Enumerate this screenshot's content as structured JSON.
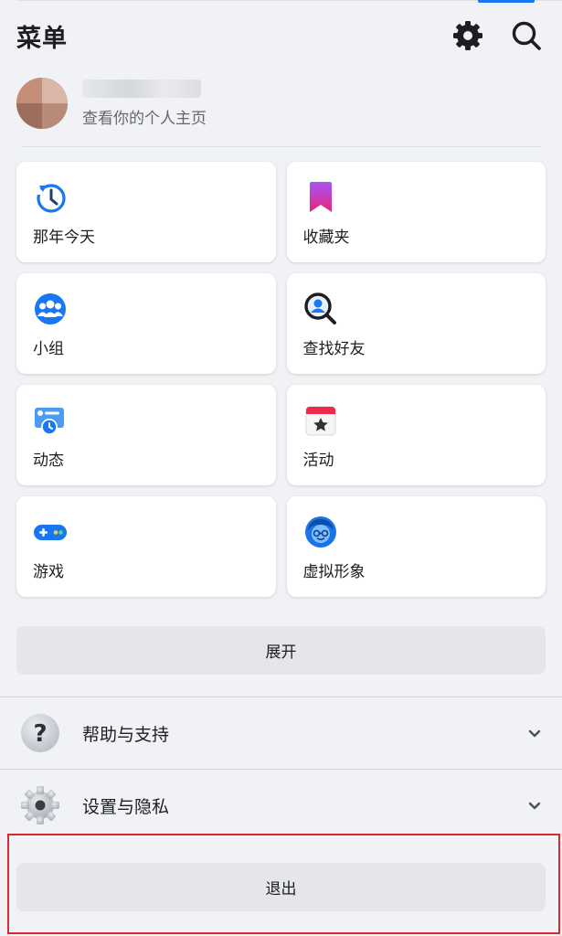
{
  "header": {
    "title": "菜单",
    "settings_icon": "gear-icon",
    "search_icon": "search-icon"
  },
  "profile": {
    "subtitle": "查看你的个人主页"
  },
  "shortcuts": [
    {
      "label": "那年今天",
      "icon": "history-clock-icon"
    },
    {
      "label": "收藏夹",
      "icon": "bookmark-icon"
    },
    {
      "label": "小组",
      "icon": "groups-icon"
    },
    {
      "label": "查找好友",
      "icon": "find-friends-icon"
    },
    {
      "label": "动态",
      "icon": "feeds-icon"
    },
    {
      "label": "活动",
      "icon": "events-calendar-icon"
    },
    {
      "label": "游戏",
      "icon": "gamepad-icon"
    },
    {
      "label": "虚拟形象",
      "icon": "avatar-icon"
    }
  ],
  "expand_label": "展开",
  "sections": [
    {
      "label": "帮助与支持",
      "icon": "help-question-icon"
    },
    {
      "label": "设置与隐私",
      "icon": "settings-gear-icon"
    }
  ],
  "logout_label": "退出",
  "colors": {
    "background": "#f0f2f5",
    "accent": "#1877f2",
    "highlight_border": "#d9282f"
  }
}
